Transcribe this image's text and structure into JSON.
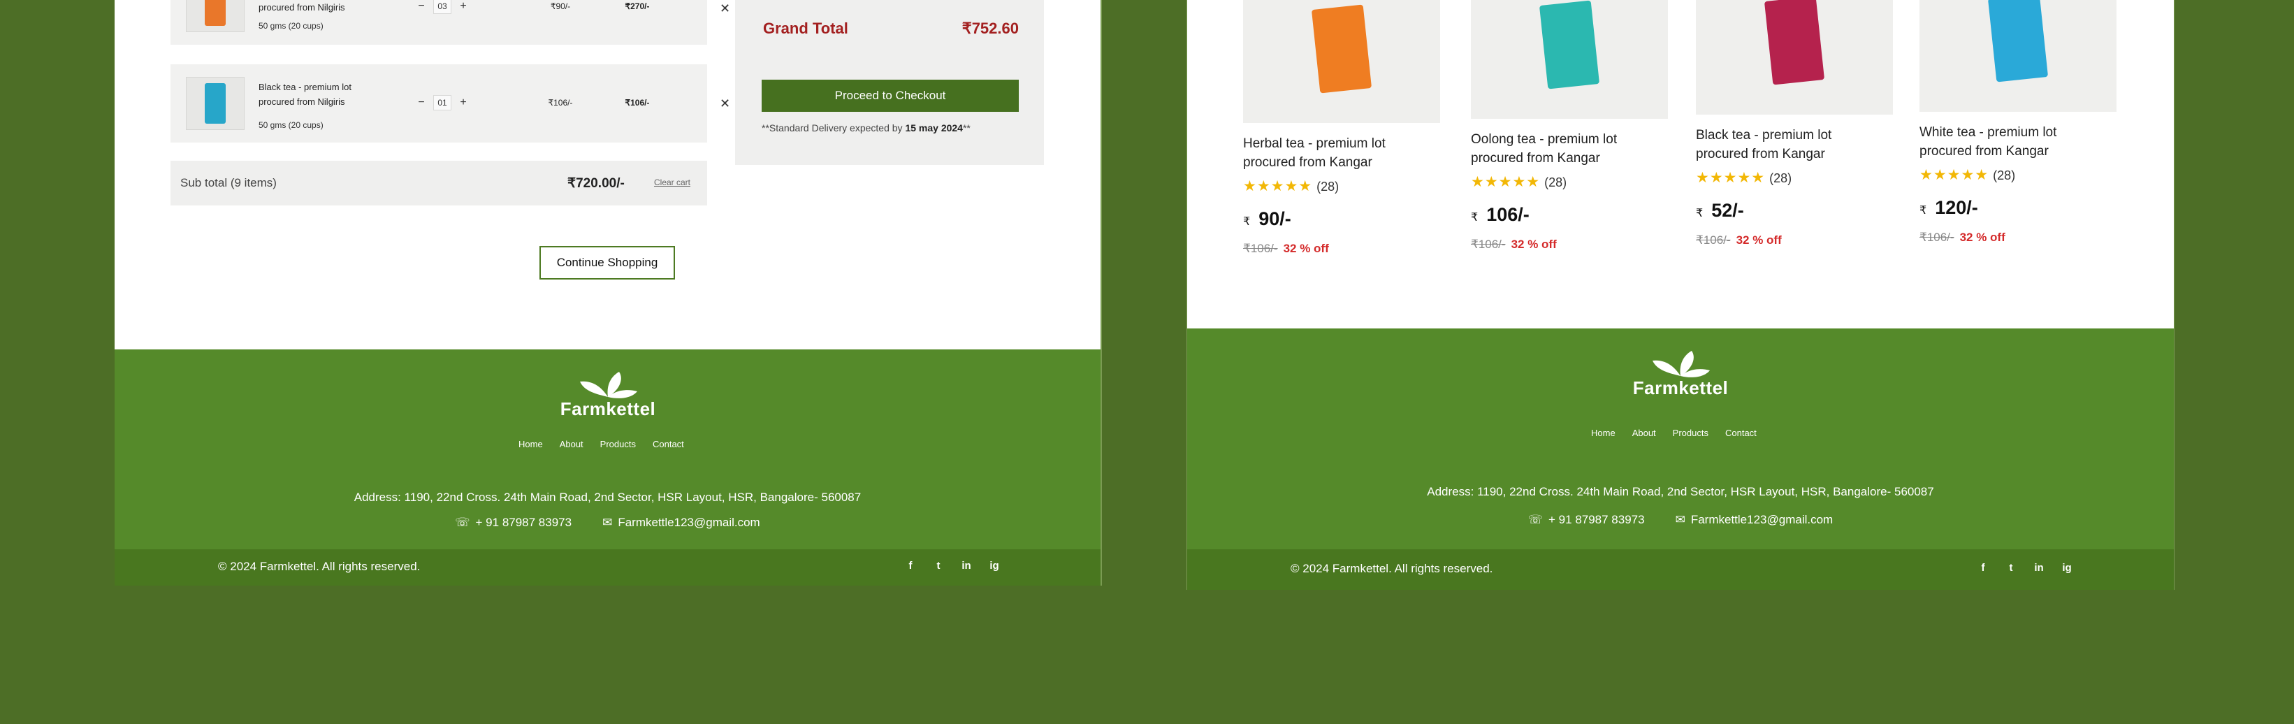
{
  "cart": {
    "items": [
      {
        "name": "procured from Nilgiris",
        "weight": "50 gms (20 cups)",
        "qty": "03",
        "unit_price": "₹90/-",
        "total": "₹270/-",
        "pack_color": "#e9772a"
      },
      {
        "name": "Black tea - premium lot procured from Nilgiris",
        "weight": "50 gms (20 cups)",
        "qty": "01",
        "unit_price": "₹106/-",
        "total": "₹106/-",
        "pack_color": "#27a6c9"
      }
    ],
    "minus": "−",
    "plus": "+",
    "remove": "✕",
    "subtotal_label": "Sub total (9 items)",
    "subtotal_value": "₹720.00/-",
    "clear_label": "Clear cart",
    "continue_label": "Continue Shopping"
  },
  "summary": {
    "grand_total_label": "Grand Total",
    "grand_total_value": "₹752.60",
    "checkout_label": "Proceed to Checkout",
    "delivery_prefix": "**Standard Delivery expected by ",
    "delivery_date": "15 may 2024",
    "delivery_suffix": "**"
  },
  "products": [
    {
      "name": "Herbal tea - premium lot procured from Kangar",
      "stars": "★★★★★",
      "reviews": "(28)",
      "currency": "₹",
      "price": "90/-",
      "old_price": "₹106/-",
      "discount": "32 % off",
      "color": "#ef7d22"
    },
    {
      "name": "Oolong tea - premium lot procured from Kangar",
      "stars": "★★★★★",
      "reviews": "(28)",
      "currency": "₹",
      "price": "106/-",
      "old_price": "₹106/-",
      "discount": "32 % off",
      "color": "#2bb8b0"
    },
    {
      "name": "Black tea - premium lot procured from Kangar",
      "stars": "★★★★★",
      "reviews": "(28)",
      "currency": "₹",
      "price": "52/-",
      "old_price": "₹106/-",
      "discount": "32 % off",
      "color": "#b5224d"
    },
    {
      "name": "White tea - premium lot procured from Kangar",
      "stars": "★★★★★",
      "reviews": "(28)",
      "currency": "₹",
      "price": "120/-",
      "old_price": "₹106/-",
      "discount": "32 % off",
      "color": "#2aa9d8"
    }
  ],
  "footer": {
    "brand": "Farmkettel",
    "nav": [
      "Home",
      "About",
      "Products",
      "Contact"
    ],
    "address": "Address: 1190, 22nd Cross. 24th Main Road, 2nd Sector, HSR Layout, HSR, Bangalore- 560087",
    "phone": "+ 91 87987 83973",
    "email": "Farmkettle123@gmail.com",
    "copyright": "© 2024 Farmkettel. All rights reserved.",
    "social": [
      "f",
      "t",
      "in",
      "ig"
    ],
    "social_icons": [
      "facebook-icon",
      "twitter-icon",
      "linkedin-icon",
      "instagram-icon"
    ]
  },
  "colors": {
    "brand_green": "#558a2a",
    "footer_bottom": "#49771f",
    "price_red": "#a32020",
    "discount_red": "#d42a2a",
    "star": "#f2b705"
  }
}
